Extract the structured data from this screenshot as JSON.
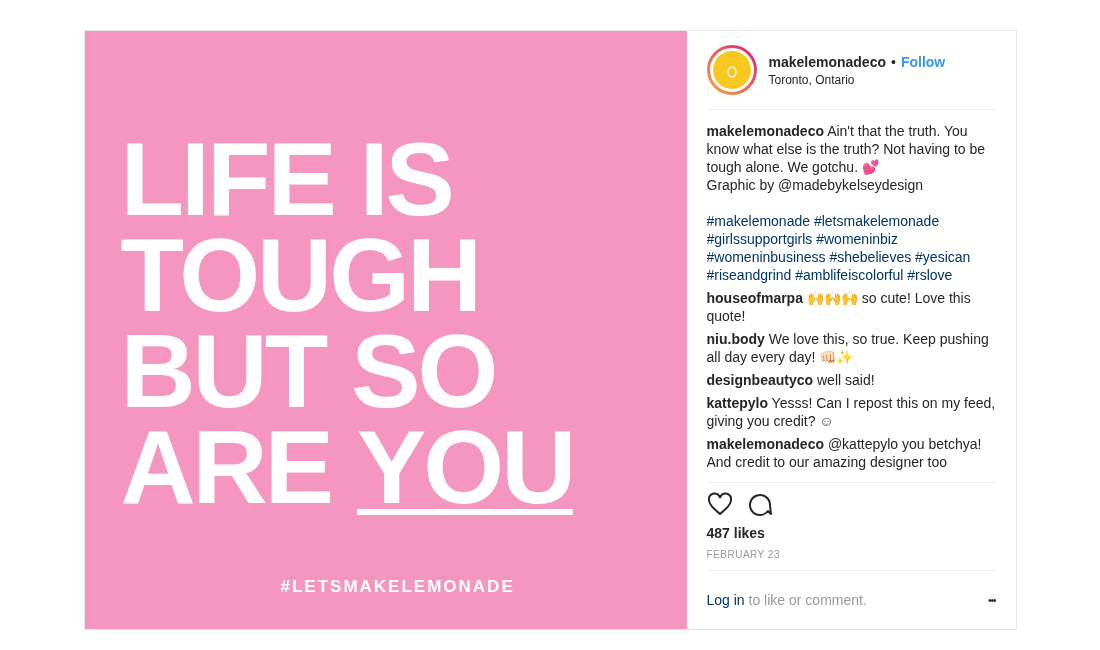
{
  "post_image": {
    "lines": [
      [
        {
          "text": "LIFE IS",
          "underlined": false
        }
      ],
      [
        {
          "text": "TOUGH",
          "underlined": false
        }
      ],
      [
        {
          "text": "BUT SO",
          "underlined": false
        }
      ],
      [
        {
          "text": "ARE ",
          "underlined": false
        },
        {
          "text": "YOU",
          "underlined": true
        }
      ]
    ],
    "hashtag": "#LETSMAKELEMONADE"
  },
  "header": {
    "username": "makelemonadeco",
    "separator": "•",
    "follow": "Follow",
    "location": "Toronto, Ontario"
  },
  "caption": {
    "username": "makelemonadeco",
    "lines": [
      "Ain't that the truth. You know what else is the truth? Not having to be tough alone. We gotchu. 💕",
      "Graphic by @madebykelseydesign"
    ],
    "hashtags": "#makelemonade #letsmakelemonade #girlssupportgirls #womeninbiz #womeninbusiness #shebelieves #yesican #riseandgrind #amblifeiscolorful #rslove"
  },
  "comments": [
    {
      "username": "houseofmarpa",
      "text": "🙌🙌🙌 so cute! Love this quote!"
    },
    {
      "username": "niu.body",
      "text": "We love this, so true. Keep pushing all day every day! 👊🏻✨"
    },
    {
      "username": "designbeautyco",
      "text": "well said!"
    },
    {
      "username": "kattepylo",
      "text": "Yesss! Can I repost this on my feed, giving you credit? ☺"
    },
    {
      "username": "makelemonadeco",
      "text": "@kattepylo you betchya! And credit to our amazing designer too"
    }
  ],
  "likes": "487 likes",
  "date": "FEBRUARY 23",
  "login": {
    "link": "Log in",
    "text": "to like or comment."
  },
  "more": "•••"
}
